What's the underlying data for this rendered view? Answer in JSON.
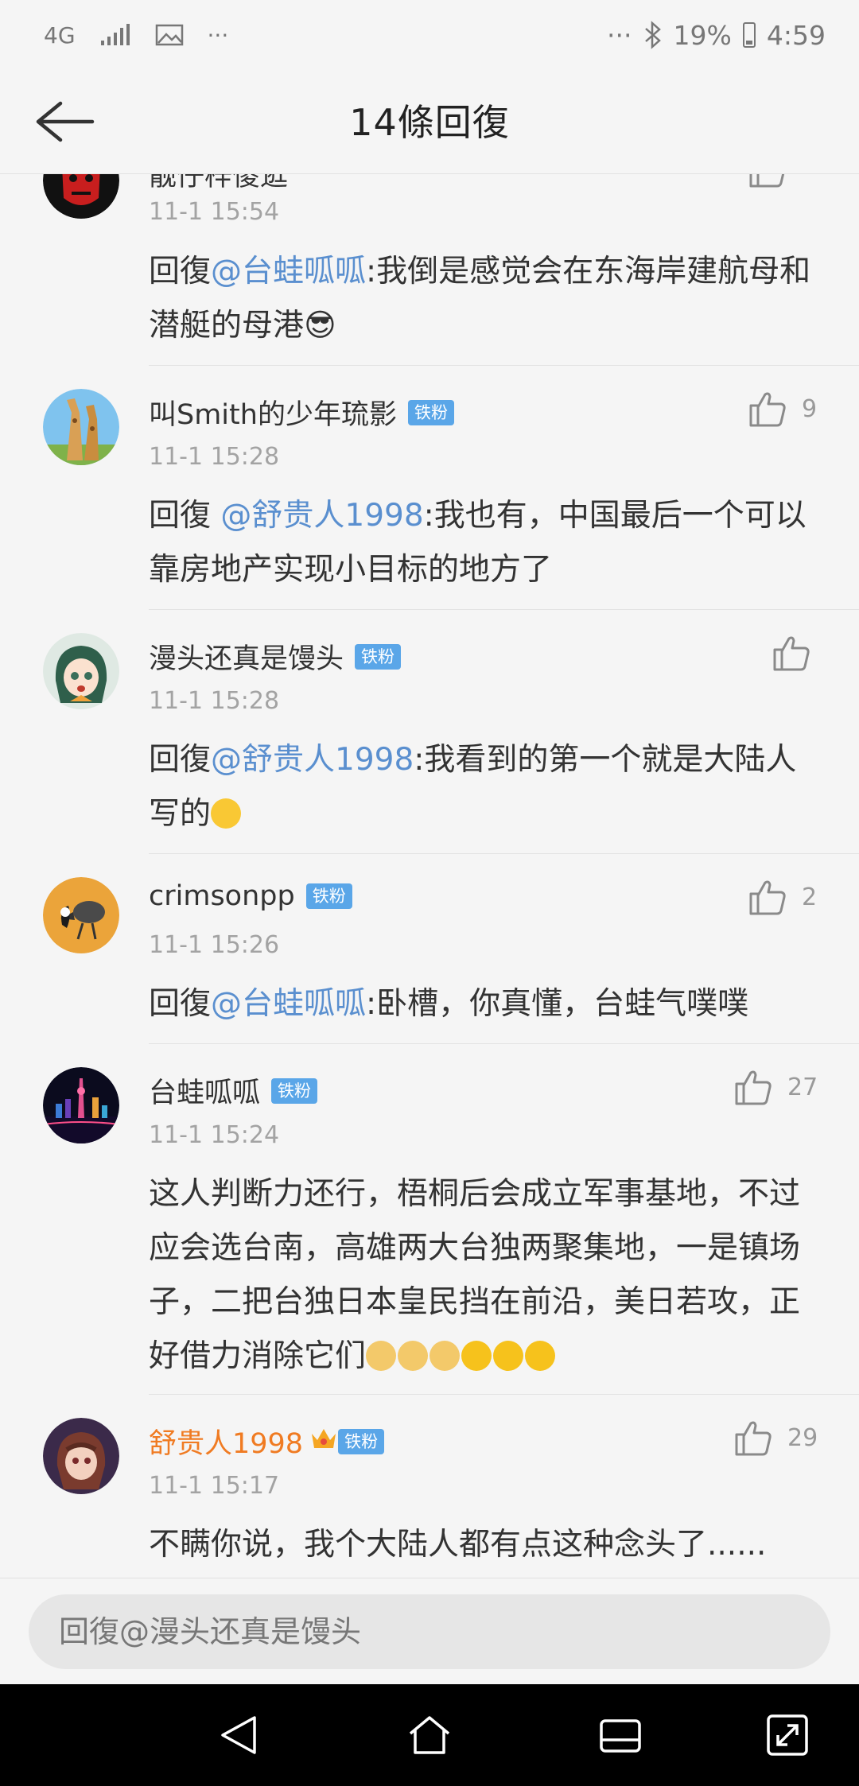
{
  "status_bar": {
    "network": "4G",
    "more_left": "···",
    "more_right": "···",
    "battery": "19%",
    "time": "4:59"
  },
  "header": {
    "title": "14條回復"
  },
  "comments": [
    {
      "username": "靓仔梓傻逛",
      "time": "11-1 15:54",
      "content_prefix": "回復",
      "mention": "@台蛙呱呱",
      "content_text": ":我倒是感觉会在东海岸建航母和潜艇的母港😎",
      "likes": ""
    },
    {
      "username": "叫Smith的少年琉影",
      "badge": "铁粉",
      "time": "11-1 15:28",
      "content_prefix": "回復 ",
      "mention": "@舒贵人1998",
      "content_text": ":我也有，中国最后一个可以靠房地产实现小目标的地方了",
      "likes": "9"
    },
    {
      "username": "漫头还真是馒头",
      "badge": "铁粉",
      "time": "11-1 15:28",
      "content_prefix": "回復",
      "mention": "@舒贵人1998",
      "content_text": ":我看到的第一个就是大陆人写的",
      "likes": ""
    },
    {
      "username": "crimsonpp",
      "badge": "铁粉",
      "time": "11-1 15:26",
      "content_prefix": "回復",
      "mention": "@台蛙呱呱",
      "content_text": ":卧槽，你真懂，台蛙气噗噗",
      "likes": "2"
    },
    {
      "username": "台蛙呱呱",
      "badge": "铁粉",
      "time": "11-1 15:24",
      "content_text": "这人判断力还行，梧桐后会成立军事基地，不过应会选台南，高雄两大台独两聚集地，一是镇场子，二把台独日本皇民挡在前沿，美日若攻，正好借力消除它们",
      "likes": "27"
    },
    {
      "username": "舒贵人1998",
      "badge": "铁粉",
      "time": "11-1 15:17",
      "content_text": "不瞒你说，我个大陆人都有点这种念头了......",
      "likes": "29"
    }
  ],
  "reply_input": {
    "placeholder": "回復@漫头还真是馒头"
  },
  "colors": {
    "mention": "#5a8fcf",
    "badge": "#5aa6e8",
    "vip_username": "#f07b22",
    "background": "#f5f5f5"
  },
  "icons": [
    "back-arrow-icon",
    "thumbs-up-icon",
    "nav-back-icon",
    "nav-home-icon",
    "nav-recents-icon",
    "nav-expand-icon"
  ]
}
